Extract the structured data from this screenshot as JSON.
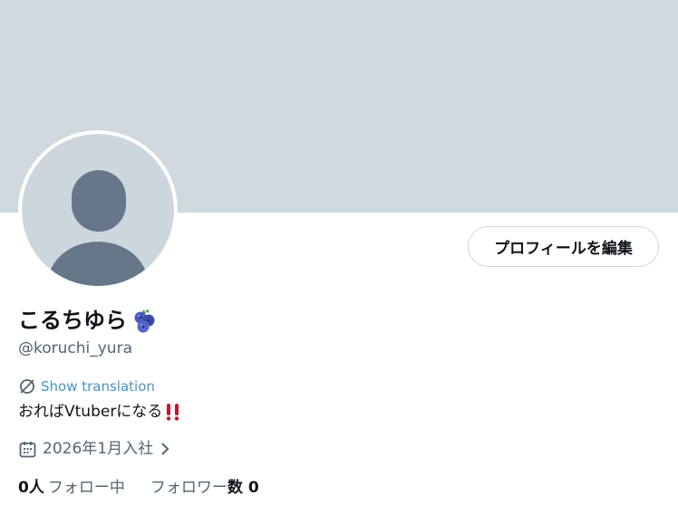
{
  "profile": {
    "display_name": "こるちゆら",
    "name_emoji": "blueberry-icon",
    "handle": "@koruchi_yura",
    "edit_button_label": "プロフィールを編集",
    "translate_label": "Show translation",
    "bio_text": "おればVtuberになる",
    "bio_emoji": "double-exclamation-icon",
    "joined_text": "2026年1月入社",
    "following_count": "0人",
    "following_label": "フォロー中",
    "followers_label_part1": "フォロワー",
    "followers_label_part2": "数",
    "followers_count": "0"
  },
  "colors": {
    "banner": "#cfd9de",
    "avatar_bg": "#ccd6dd",
    "avatar_figure": "#66778a",
    "link": "#1d9bf0",
    "secondary_text": "#536471",
    "exclamation": "#be1931"
  }
}
